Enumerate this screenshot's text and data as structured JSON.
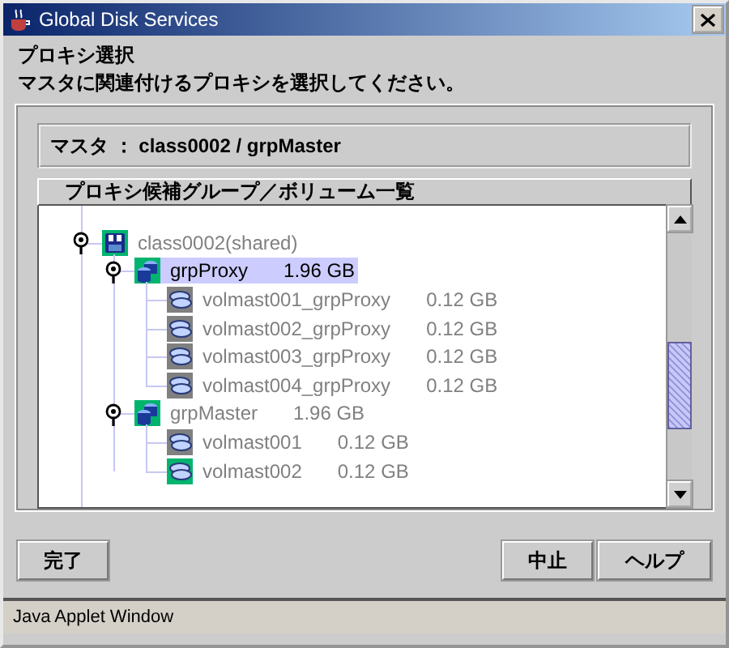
{
  "window": {
    "title": "Global Disk Services"
  },
  "heading": "プロキシ選択",
  "instruction": "マスタに関連付けるプロキシを選択してください。",
  "master_label": "マスタ ： class0002 / grpMaster",
  "list": {
    "header": "プロキシ候補グループ／ボリューム一覧",
    "nodes": [
      {
        "kind": "class",
        "name": "class0002(shared)",
        "expanded": true,
        "selected": false,
        "disabled": true,
        "color": "#00b46e",
        "children": [
          {
            "kind": "group",
            "name": "grpProxy",
            "size": "1.96 GB",
            "expanded": true,
            "selected": true,
            "disabled": false,
            "color": "#00b46e",
            "children": [
              {
                "kind": "volume",
                "name": "volmast001_grpProxy",
                "size": "0.12 GB",
                "selected": false,
                "disabled": true,
                "color": "#808080"
              },
              {
                "kind": "volume",
                "name": "volmast002_grpProxy",
                "size": "0.12 GB",
                "selected": false,
                "disabled": true,
                "color": "#808080"
              },
              {
                "kind": "volume",
                "name": "volmast003_grpProxy",
                "size": "0.12 GB",
                "selected": false,
                "disabled": true,
                "color": "#808080"
              },
              {
                "kind": "volume",
                "name": "volmast004_grpProxy",
                "size": "0.12 GB",
                "selected": false,
                "disabled": true,
                "color": "#808080"
              }
            ]
          },
          {
            "kind": "group",
            "name": "grpMaster",
            "size": "1.96 GB",
            "expanded": true,
            "selected": false,
            "disabled": true,
            "color": "#00b46e",
            "children": [
              {
                "kind": "volume",
                "name": "volmast001",
                "size": "0.12 GB",
                "selected": false,
                "disabled": true,
                "color": "#808080"
              },
              {
                "kind": "volume",
                "name": "volmast002",
                "size": "0.12 GB",
                "selected": false,
                "disabled": true,
                "color": "#00b46e"
              }
            ]
          }
        ]
      }
    ]
  },
  "buttons_left": [
    "完了"
  ],
  "buttons_right": [
    "中止",
    "ヘルプ"
  ],
  "status_bar": "Java Applet Window"
}
